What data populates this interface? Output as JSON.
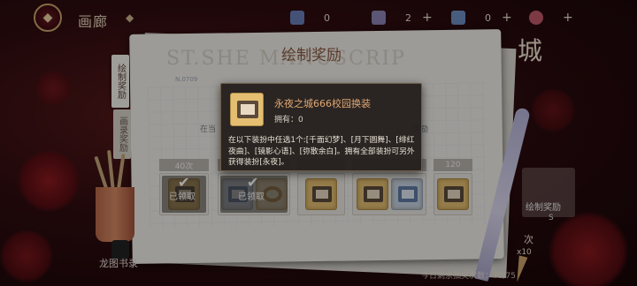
{
  "topbar": {
    "back_icon": "back-emblem-icon",
    "title": "画廊",
    "resources": [
      {
        "name": "resource-1",
        "value": "0",
        "color": "#6a7fb8",
        "has_plus": false
      },
      {
        "name": "resource-2",
        "value": "2",
        "color": "#8d84b5",
        "has_plus": true
      },
      {
        "name": "resource-3",
        "value": "0",
        "color": "#6f8fc0",
        "has_plus": true
      },
      {
        "name": "resource-4",
        "value": "",
        "color": "#c05a6a",
        "has_plus": true
      }
    ]
  },
  "book": {
    "title": "绘制奖励",
    "watermark": "ST.SHE  MANUSCRIP",
    "no_label": "N.0709",
    "desc_left": "在当",
    "desc_right": "奖励",
    "tabs": [
      {
        "label": "绘制奖励",
        "active": true
      },
      {
        "label": "画录奖励",
        "active": false
      }
    ],
    "milestones": [
      {
        "label": "40次"
      },
      {
        "label": ""
      },
      {
        "label": ""
      },
      {
        "label": ""
      },
      {
        "label": "120"
      }
    ],
    "claimed_label": "已领取",
    "bottom_left_label": "龙图书录"
  },
  "right_panel": {
    "title": "城",
    "card_label": "绘制奖励",
    "card_sub": "S",
    "count_label": "次",
    "multiplier": "x10",
    "bottom_hint": "今日剩余抽奖次数：70/75"
  },
  "tooltip": {
    "title": "永夜之城666校园换装",
    "owned": "拥有：0",
    "body": "在以下装扮中任选1个:[千面幻梦]、[月下圆舞]、[绯红夜曲]、[镜影心语]、[弥散余白]。拥有全部装扮可另外获得装扮[永夜]。"
  },
  "colors": {
    "background": "#2e0c0f",
    "accent_gold": "#c9a46a",
    "tooltip_title": "#e2a774",
    "page": "#f1eee8"
  }
}
